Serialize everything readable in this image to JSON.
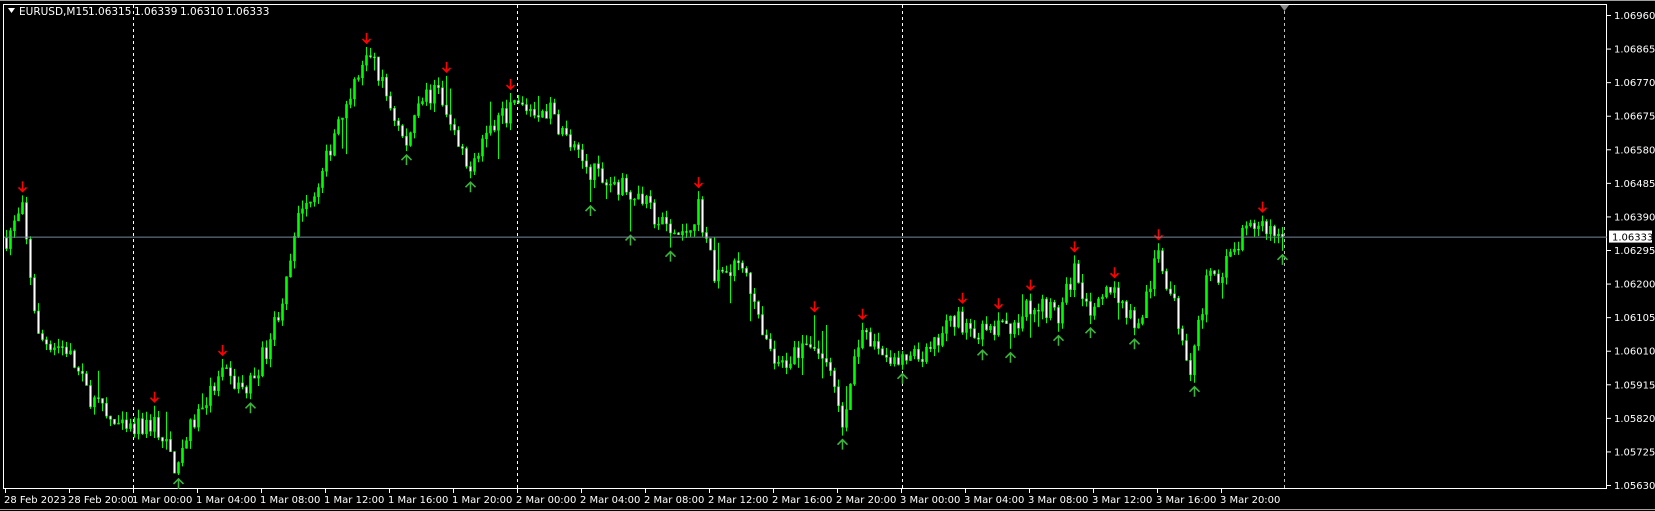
{
  "header": {
    "symbol": "EURUSD,M15",
    "open": "1.06315",
    "high": "1.06339",
    "low": "1.06310",
    "close": "1.06333"
  },
  "current_price_label": "1.06333",
  "colors": {
    "background": "#000000",
    "candle": "#00ff00",
    "candle_bear_fill": "#ffffff",
    "sell_arrow": "#ff0000",
    "buy_arrow": "#3cb43c",
    "grid_separator": "#ffffff",
    "price_line": "#778899"
  },
  "chart_data": {
    "type": "candlestick",
    "symbol": "EURUSD",
    "timeframe": "M15",
    "ylim": [
      1.0563,
      1.0696
    ],
    "y_ticks": [
      "1.06960",
      "1.06865",
      "1.06770",
      "1.06675",
      "1.06580",
      "1.06485",
      "1.06390",
      "1.06295",
      "1.06200",
      "1.06105",
      "1.06010",
      "1.05915",
      "1.05820",
      "1.05725",
      "1.05630"
    ],
    "x_ticks": [
      "28 Feb 2023",
      "28 Feb 20:00",
      "1 Mar 00:00",
      "1 Mar 04:00",
      "1 Mar 08:00",
      "1 Mar 12:00",
      "1 Mar 16:00",
      "1 Mar 20:00",
      "2 Mar 00:00",
      "2 Mar 04:00",
      "2 Mar 08:00",
      "2 Mar 12:00",
      "2 Mar 16:00",
      "2 Mar 20:00",
      "3 Mar 00:00",
      "3 Mar 04:00",
      "3 Mar 08:00",
      "3 Mar 12:00",
      "3 Mar 16:00",
      "3 Mar 20:00"
    ],
    "bars_total": 320,
    "price_path_bar_close": [
      [
        0,
        1.06329
      ],
      [
        4,
        1.06404
      ],
      [
        8,
        1.06045
      ],
      [
        15,
        1.06016
      ],
      [
        20,
        1.05896
      ],
      [
        25,
        1.05821
      ],
      [
        30,
        1.05776
      ],
      [
        37,
        1.05806
      ],
      [
        42,
        1.05687
      ],
      [
        48,
        1.05836
      ],
      [
        54,
        1.05941
      ],
      [
        60,
        1.05896
      ],
      [
        65,
        1.06016
      ],
      [
        70,
        1.06195
      ],
      [
        74,
        1.06434
      ],
      [
        78,
        1.06464
      ],
      [
        83,
        1.06673
      ],
      [
        91,
        1.06852
      ],
      [
        95,
        1.06733
      ],
      [
        100,
        1.06583
      ],
      [
        103,
        1.06733
      ],
      [
        108,
        1.06733
      ],
      [
        115,
        1.06524
      ],
      [
        120,
        1.06628
      ],
      [
        127,
        1.06703
      ],
      [
        136,
        1.06688
      ],
      [
        143,
        1.06553
      ],
      [
        149,
        1.06494
      ],
      [
        157,
        1.06464
      ],
      [
        163,
        1.06374
      ],
      [
        169,
        1.06329
      ],
      [
        173,
        1.06419
      ],
      [
        177,
        1.06225
      ],
      [
        184,
        1.0627
      ],
      [
        189,
        1.06045
      ],
      [
        193,
        1.05956
      ],
      [
        200,
        1.06045
      ],
      [
        205,
        1.05986
      ],
      [
        209,
        1.05791
      ],
      [
        213,
        1.06045
      ],
      [
        218,
        1.06016
      ],
      [
        223,
        1.05971
      ],
      [
        231,
        1.06001
      ],
      [
        237,
        1.06106
      ],
      [
        243,
        1.0606
      ],
      [
        250,
        1.06075
      ],
      [
        258,
        1.0615
      ],
      [
        263,
        1.06106
      ],
      [
        267,
        1.0624
      ],
      [
        272,
        1.06106
      ],
      [
        276,
        1.06195
      ],
      [
        283,
        1.06075
      ],
      [
        288,
        1.06285
      ],
      [
        292,
        1.06135
      ],
      [
        296,
        1.05971
      ],
      [
        300,
        1.06195
      ],
      [
        306,
        1.0627
      ],
      [
        309,
        1.06329
      ],
      [
        313,
        1.06374
      ],
      [
        319,
        1.06333
      ]
    ]
  }
}
